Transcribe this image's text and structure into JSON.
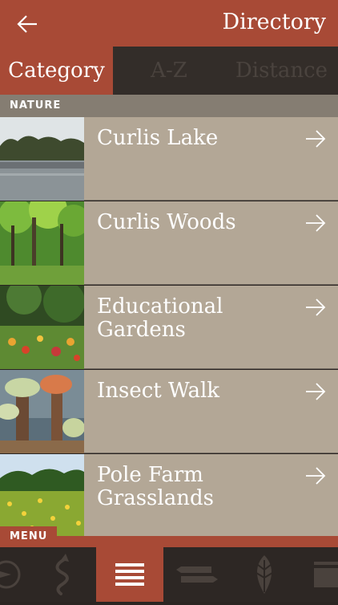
{
  "header": {
    "title": "Directory",
    "back_icon": "arrow-left-icon"
  },
  "tabs": [
    {
      "label": "Category",
      "active": true
    },
    {
      "label": "A-Z",
      "active": false
    },
    {
      "label": "Distance",
      "active": false
    }
  ],
  "section": {
    "label": "NATURE"
  },
  "items": [
    {
      "label": "Curlis Lake",
      "image": "lake-photo"
    },
    {
      "label": "Curlis Woods",
      "image": "woods-photo"
    },
    {
      "label": "Educational Gardens",
      "image": "gardens-photo"
    },
    {
      "label": "Insect Walk",
      "image": "sculpture-photo"
    },
    {
      "label": "Pole Farm Grasslands",
      "image": "grassland-photo"
    }
  ],
  "menu": {
    "label": "MENU",
    "icons": [
      "compass-icon",
      "trail-icon",
      "list-icon",
      "signpost-icon",
      "leaf-icon",
      "panel-icon"
    ],
    "active_index": 2
  },
  "colors": {
    "accent": "#a84a36",
    "row_bg": "#b3a796",
    "section_bg": "#857d72",
    "dark": "#2d2724"
  }
}
